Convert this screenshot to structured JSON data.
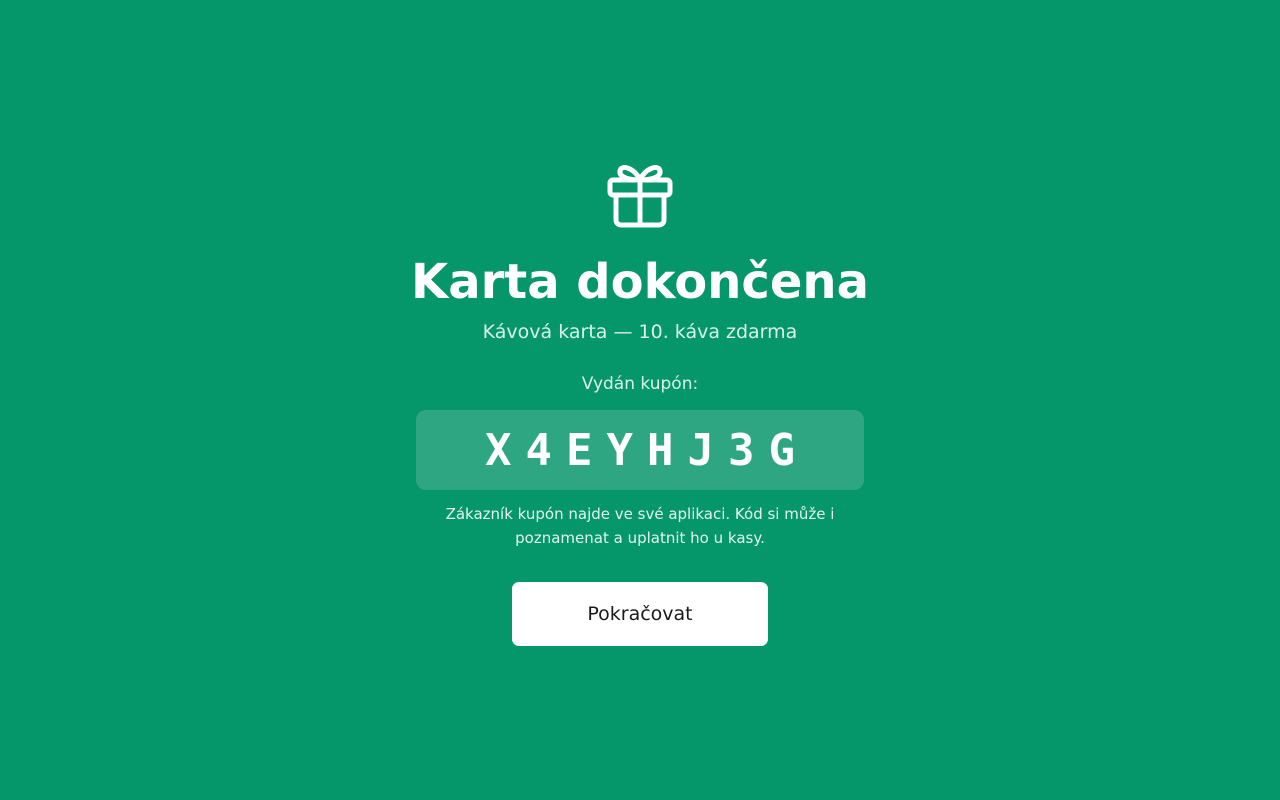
{
  "icon": "gift-icon",
  "colors": {
    "background": "#059669",
    "text": "#ffffff",
    "button_background": "#ffffff",
    "button_text": "#1a1a1a"
  },
  "completion": {
    "title": "Karta dokončena",
    "subtitle": "Kávová karta — 10. káva zdarma"
  },
  "coupon": {
    "label": "Vydán kupón:",
    "code": "X4EYHJ3G",
    "hint": "Zákazník kupón najde ve své aplikaci. Kód si může i poznamenat a uplatnit ho u kasy."
  },
  "actions": {
    "continue_label": "Pokračovat"
  }
}
